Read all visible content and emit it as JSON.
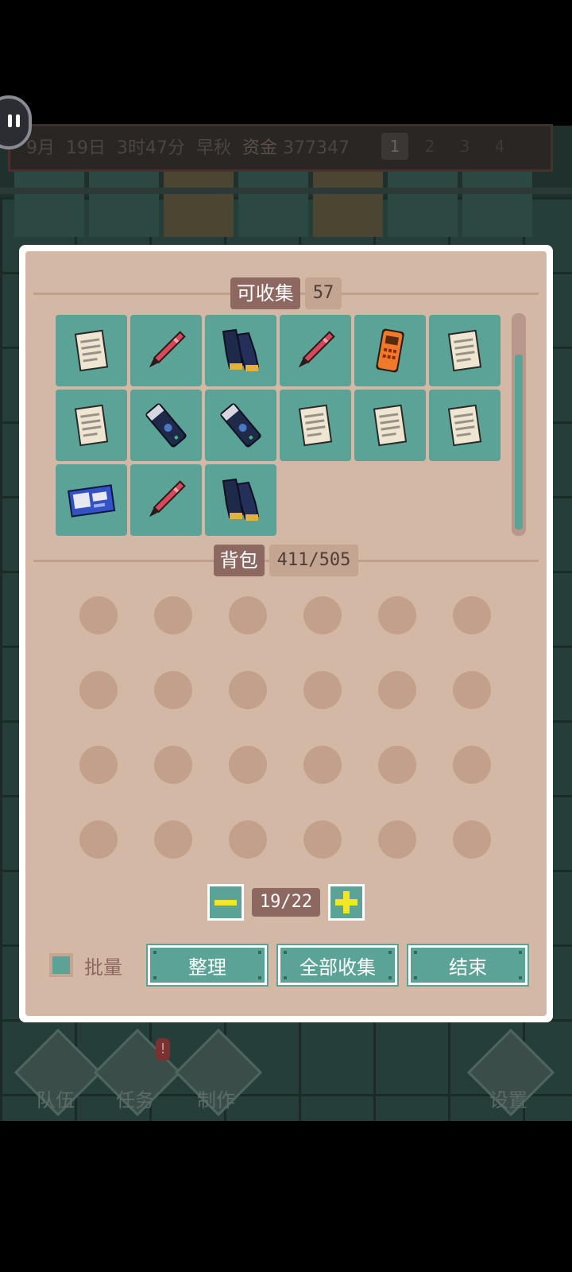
{
  "status_bar": {
    "month": "9月",
    "day": "19日",
    "time": "3时47分",
    "season": "早秋",
    "money_label": "资金",
    "money_value": "377347",
    "page_tabs": [
      "1",
      "2",
      "3",
      "4"
    ],
    "active_page": "1"
  },
  "bottom_nav": {
    "items": [
      {
        "label": "队伍",
        "icon": "team-card-icon"
      },
      {
        "label": "任务",
        "icon": "quest-glasses-icon",
        "badge": "!"
      },
      {
        "label": "制作",
        "icon": "crafting-tools-icon"
      },
      {
        "label": "设置",
        "icon": "settings-gear-icon"
      }
    ]
  },
  "collectable": {
    "title": "可收集",
    "count": "57",
    "items": [
      "paper-icon",
      "pen-icon",
      "gloves-icon",
      "pen-icon",
      "walkie-talkie-icon",
      "paper-icon",
      "paper-icon",
      "thermos-icon",
      "thermos-icon",
      "paper-icon",
      "paper-icon",
      "paper-icon",
      "id-card-icon",
      "pen-icon",
      "gloves-icon"
    ],
    "scroll_position": 0.1
  },
  "backpack": {
    "title": "背包",
    "capacity": "411/505",
    "empty_slots": 24
  },
  "pager": {
    "indicator": "19/22"
  },
  "footer": {
    "bulk_label": "批量",
    "buttons": [
      "整理",
      "全部收集",
      "结束"
    ]
  },
  "colors": {
    "panel": "#d3b8a6",
    "slot": "#5aa396",
    "label_box": "#8d6860",
    "accent_yellow": "#f2e625"
  }
}
